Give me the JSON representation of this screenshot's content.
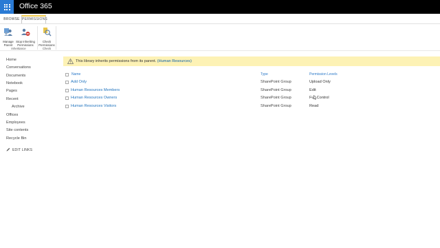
{
  "suite": {
    "title": "Office 365"
  },
  "ribbon": {
    "tabs": [
      {
        "label": "BROWSE"
      },
      {
        "label": "PERMISSIONS"
      }
    ],
    "buttons": {
      "manage_parent": "Manage Parent",
      "stop_inheriting": "Stop Inheriting Permissions",
      "check_permissions": "Check Permissions"
    },
    "groups": {
      "inheritance": "Inheritance",
      "check": "Check"
    }
  },
  "nav": {
    "items": [
      {
        "label": "Home"
      },
      {
        "label": "Conversations"
      },
      {
        "label": "Documents"
      },
      {
        "label": "Notebook"
      },
      {
        "label": "Pages"
      },
      {
        "label": "Recent"
      },
      {
        "label": "Archive"
      },
      {
        "label": "Offices"
      },
      {
        "label": "Employees"
      },
      {
        "label": "Site contents"
      },
      {
        "label": "Recycle Bin"
      }
    ],
    "edit_links": "EDIT LINKS"
  },
  "banner": {
    "text": "This library inherits permissions from its parent.",
    "link": "(Human Resources)"
  },
  "table": {
    "headers": {
      "name": "Name",
      "type": "Type",
      "level": "Permission Levels"
    },
    "rows": [
      {
        "name": "Add Only",
        "type": "SharePoint Group",
        "level": "Upload Only"
      },
      {
        "name": "Human Resources Members",
        "type": "SharePoint Group",
        "level": "Edit"
      },
      {
        "name": "Human Resources Owners",
        "type": "SharePoint Group",
        "level": "Full Control"
      },
      {
        "name": "Human Resources Visitors",
        "type": "SharePoint Group",
        "level": "Read"
      }
    ]
  },
  "colors": {
    "suite_bar": "#000000",
    "waffle": "#2a7ad4",
    "banner_bg": "#fdf2b5",
    "link": "#1f73be",
    "tab_accent": "#f0c94a"
  }
}
